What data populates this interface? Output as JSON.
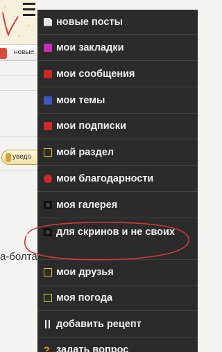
{
  "background_page": {
    "tab_label": "новые",
    "notify_label": "уведо",
    "post_fragment": "а-болта"
  },
  "menu": {
    "items": [
      {
        "label": "новые посты",
        "icon": "document-icon"
      },
      {
        "label": "мои закладки",
        "icon": "bookmark-icon"
      },
      {
        "label": "мои сообщения",
        "icon": "message-icon"
      },
      {
        "label": "мои темы",
        "icon": "topics-icon"
      },
      {
        "label": "мои подписки",
        "icon": "subscriptions-icon"
      },
      {
        "label": "мой раздел",
        "icon": "section-box-icon"
      },
      {
        "label": "мои благодарности",
        "icon": "heart-icon"
      },
      {
        "label": "моя галерея",
        "icon": "camera-icon"
      },
      {
        "label": "для скринов и не своих",
        "icon": "camera-icon"
      },
      {
        "label": "мои друзья",
        "icon": "friends-box-icon"
      },
      {
        "label": "моя погода",
        "icon": "weather-box-icon"
      },
      {
        "label": "добавить рецепт",
        "icon": "fork-knife-icon"
      },
      {
        "label": "задать вопрос",
        "icon": "question-icon"
      }
    ]
  },
  "colors": {
    "menu_bg": "#2b2b2b",
    "annotation_red": "#d23a3a"
  }
}
